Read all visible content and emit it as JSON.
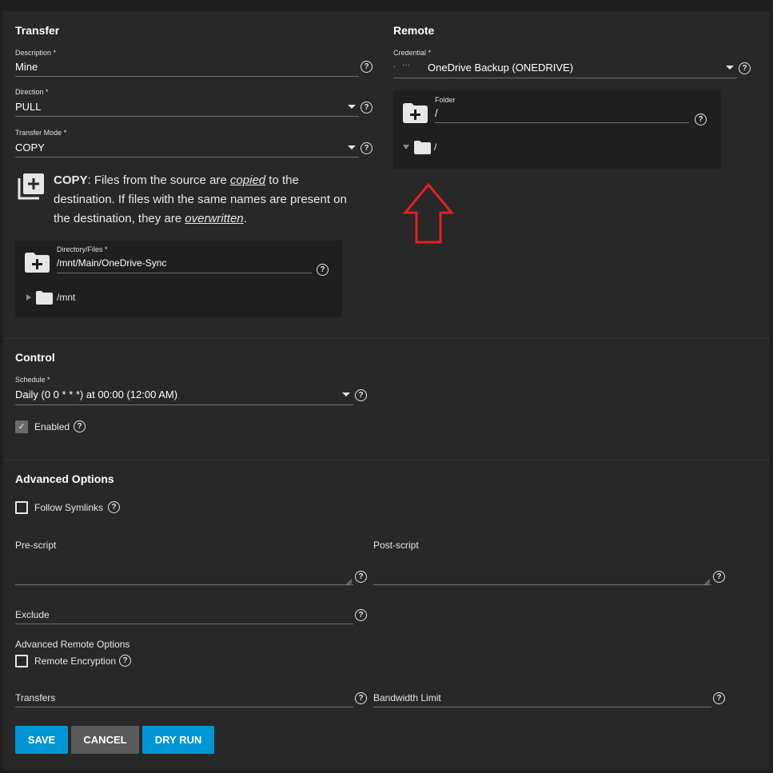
{
  "transfer": {
    "title": "Transfer",
    "description_label": "Description *",
    "description_value": "Mine",
    "direction_label": "Direction *",
    "direction_value": "PULL",
    "mode_label": "Transfer Mode *",
    "mode_value": "COPY",
    "info_bold": "COPY",
    "info_line1_rest": ": Files from the source are ",
    "info_copied": "copied",
    "info_line1_end": " to the",
    "info_line2": "destination. If files with the same names are present on",
    "info_line3_start": "the destination, they are ",
    "info_overwritten": "overwritten",
    "info_line3_end": ".",
    "dir_label": "Directory/Files *",
    "dir_value": "/mnt/Main/OneDrive-Sync",
    "tree_item": "/mnt"
  },
  "remote": {
    "title": "Remote",
    "credential_label": "Credential *",
    "credential_prefix": ".   ···",
    "credential_value": "OneDrive Backup (ONEDRIVE)",
    "folder_label": "Folder",
    "folder_value": "/",
    "tree_item": "/"
  },
  "control": {
    "title": "Control",
    "schedule_label": "Schedule *",
    "schedule_value": "Daily (0 0 * * *) at 00:00 (12:00 AM)",
    "enabled_label": "Enabled",
    "enabled_checked": true
  },
  "advanced": {
    "title": "Advanced Options",
    "follow_symlinks": "Follow Symlinks",
    "pre_script": "Pre-script",
    "post_script": "Post-script",
    "exclude": "Exclude",
    "remote_options": "Advanced Remote Options",
    "remote_encryption": "Remote Encryption",
    "transfers": "Transfers",
    "bandwidth": "Bandwidth Limit"
  },
  "buttons": {
    "save": "SAVE",
    "cancel": "CANCEL",
    "dry_run": "DRY RUN"
  },
  "colors": {
    "primary": "#0095d5",
    "cancel_bg": "#5a5a5a",
    "annotation_arrow": "#e52020"
  },
  "icons": {
    "help": "?",
    "check": "✓"
  }
}
